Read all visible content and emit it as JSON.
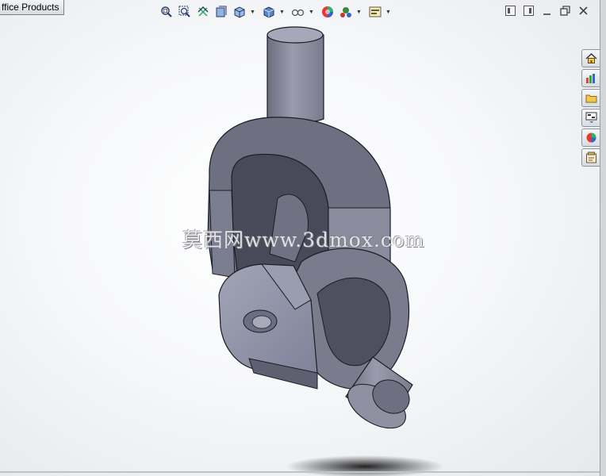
{
  "window": {
    "tab_title": "ffice Products"
  },
  "view_toolbar": {
    "buttons": [
      {
        "icon": "zoom-to-fit-icon",
        "dropdown": false
      },
      {
        "icon": "zoom-to-area-icon",
        "dropdown": false
      },
      {
        "icon": "previous-view-icon",
        "dropdown": false
      },
      {
        "icon": "section-view-icon",
        "dropdown": false
      },
      {
        "icon": "view-orientation-icon",
        "dropdown": true
      },
      {
        "icon": "display-style-icon",
        "dropdown": true
      },
      {
        "icon": "hide-show-items-icon",
        "dropdown": true
      },
      {
        "icon": "edit-appearance-icon",
        "dropdown": false
      },
      {
        "icon": "apply-scene-icon",
        "dropdown": true
      },
      {
        "icon": "view-settings-icon",
        "dropdown": true
      }
    ]
  },
  "window_controls": [
    "tile-horizontal-icon",
    "tile-vertical-icon",
    "minimize-icon",
    "restore-icon",
    "close-icon"
  ],
  "task_pane": [
    "home-icon",
    "design-library-icon",
    "file-explorer-icon",
    "view-palette-icon",
    "appearances-icon",
    "custom-properties-icon"
  ],
  "watermark": "莫西网www.3dmox.com",
  "colors": {
    "model_face": "#8c8ea0",
    "model_dark": "#5a5c6c",
    "model_edge": "#1c1c24",
    "background": "#f4f6f8"
  }
}
